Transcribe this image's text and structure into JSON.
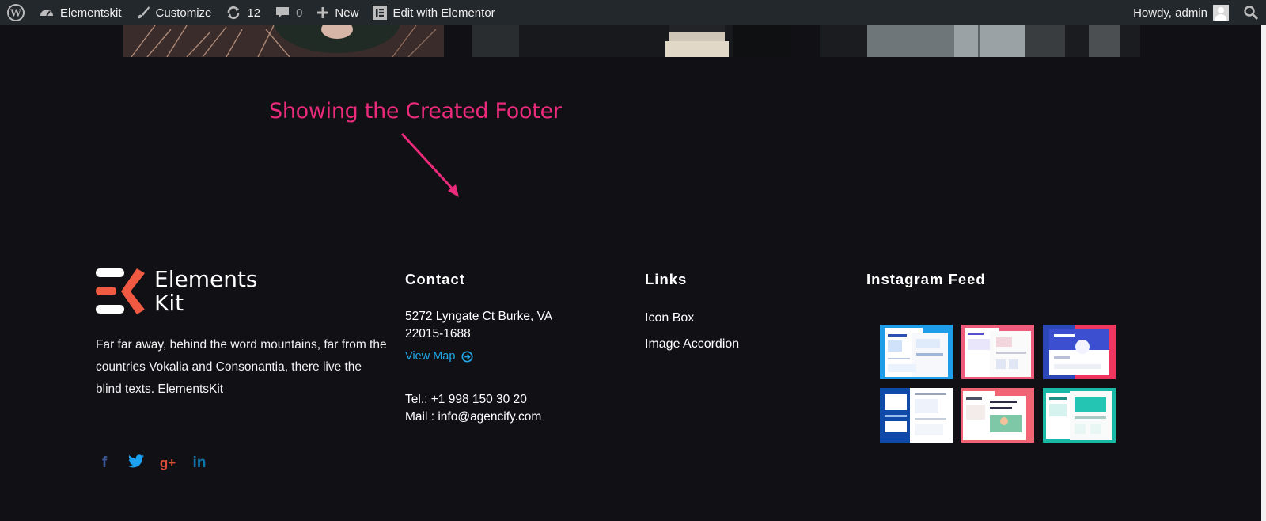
{
  "adminbar": {
    "site_name": "Elementskit",
    "customize": "Customize",
    "updates_count": "12",
    "comments_count": "0",
    "new_label": "New",
    "edit_label": "Edit with Elementor",
    "howdy": "Howdy, admin"
  },
  "annotation": {
    "text": "Showing the Created Footer",
    "color": "#ea2a7a"
  },
  "footer": {
    "logo_line1": "Elements",
    "logo_line2": "Kit",
    "about": "Far far away, behind the word mountains, far from the countries Vokalia and Consonantia, there live the blind texts. ElementsKit",
    "social": [
      "facebook-icon",
      "twitter-icon",
      "google-plus-icon",
      "linkedin-icon"
    ],
    "contact": {
      "title": "Contact",
      "address_line1": "5272 Lyngate Ct Burke, VA",
      "address_line2": "22015-1688",
      "view_map": "View Map",
      "tel": "Tel.: +1 998 150 30 20",
      "mail": "Mail : info@agencify.com"
    },
    "links": {
      "title": "Links",
      "items": [
        "Icon Box",
        "Image Accordion"
      ]
    },
    "instagram": {
      "title": "Instagram Feed",
      "tiles": 6
    }
  },
  "colors": {
    "background": "#111015",
    "adminbar": "#23282d",
    "link_blue": "#21a7e7",
    "logo_red": "#f15a42"
  }
}
